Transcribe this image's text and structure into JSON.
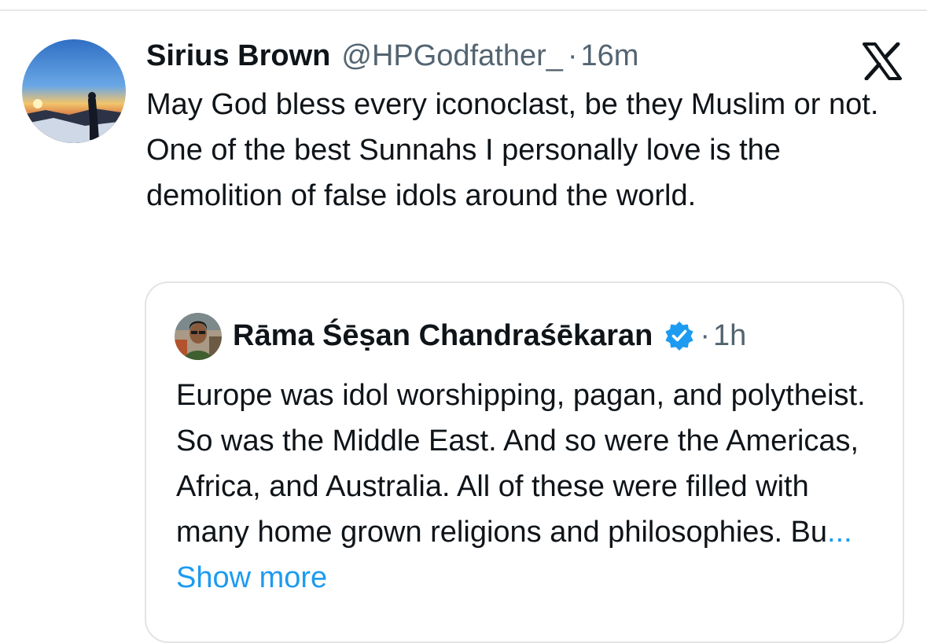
{
  "tweet": {
    "author_name": "Sirius Brown",
    "author_handle": "@HPGodfather_",
    "separator": "·",
    "time": "16m",
    "text": "May God bless every iconoclast, be they Muslim or not. One of the best Sunnahs I personally love is the demolition of false idols around the world."
  },
  "quoted_tweet": {
    "author_name": "Rāma Śēṣan Chandraśēkaran",
    "verified": true,
    "separator": "·",
    "time": "1h",
    "text": "Europe was idol worshipping, pagan, and polytheist. So was the Middle East. And so were the Americas, Africa, and Australia. All of these were filled with many home grown religions and philosophies. Bu",
    "ellipsis": "...",
    "show_more_label": "Show more"
  },
  "icons": {
    "platform_logo": "x-logo-icon",
    "verified_badge": "verified-badge-icon"
  },
  "colors": {
    "text_primary": "#0f1419",
    "text_secondary": "#536471",
    "link": "#1d9bf0",
    "verified": "#1d9bf0",
    "border": "#e1e4e7"
  }
}
